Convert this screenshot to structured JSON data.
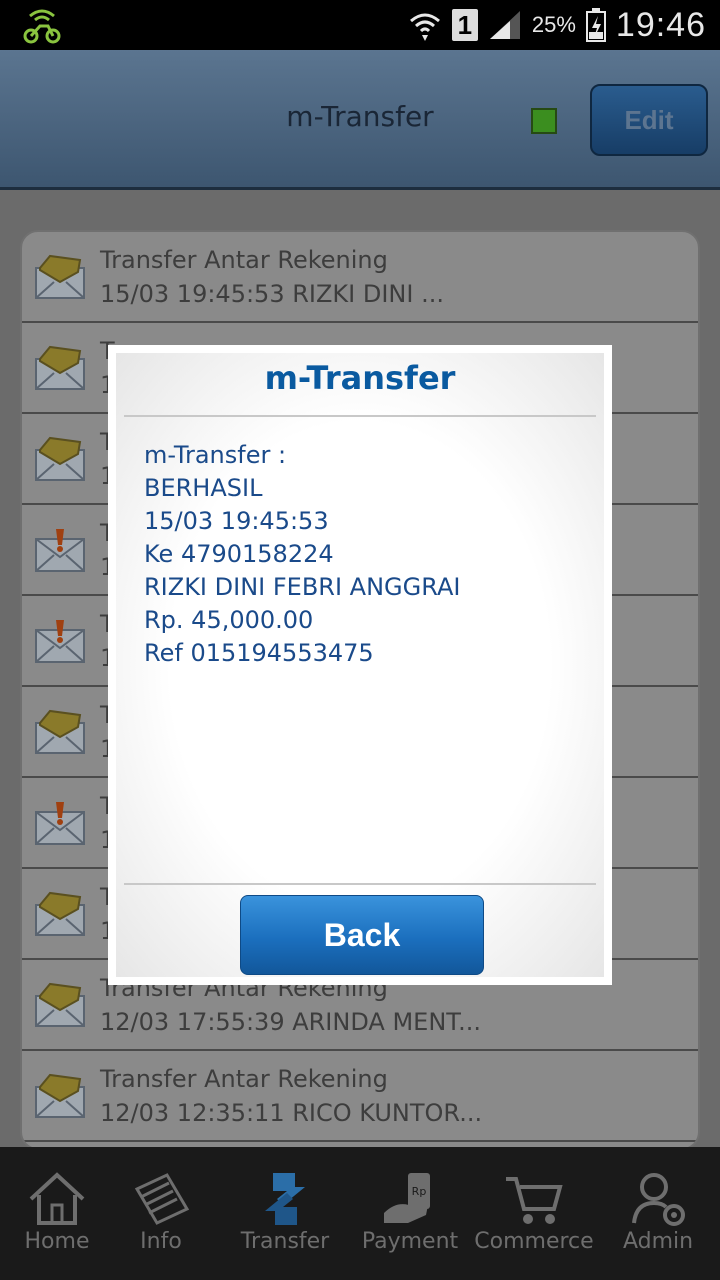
{
  "status_bar": {
    "sim_slot": "1",
    "battery_percent": "25%",
    "clock": "19:46",
    "icons": [
      "bike-notification-icon",
      "wifi-icon",
      "sim-icon",
      "signal-icon",
      "battery-icon"
    ]
  },
  "header": {
    "title": "m-Transfer",
    "edit_label": "Edit",
    "status_color": "#3b8e1f"
  },
  "inbox": {
    "items": [
      {
        "title": "Transfer Antar Rekening",
        "subtitle": "15/03 19:45:53 RIZKI DINI ...",
        "icon": "envelope-open-icon"
      },
      {
        "title": "T",
        "subtitle": "1",
        "icon": "envelope-open-icon"
      },
      {
        "title": "T",
        "subtitle": "1",
        "icon": "envelope-open-icon"
      },
      {
        "title": "T",
        "subtitle": "1",
        "icon": "envelope-flagged-icon"
      },
      {
        "title": "T",
        "subtitle": "1",
        "icon": "envelope-flagged-icon"
      },
      {
        "title": "T",
        "subtitle": "1",
        "icon": "envelope-open-icon"
      },
      {
        "title": "T",
        "subtitle": "1",
        "icon": "envelope-flagged-icon"
      },
      {
        "title": "T",
        "subtitle": "1",
        "icon": "envelope-open-icon"
      },
      {
        "title": "Transfer Antar Rekening",
        "subtitle": "12/03 17:55:39 ARINDA MENT...",
        "icon": "envelope-open-icon"
      },
      {
        "title": "Transfer Antar Rekening",
        "subtitle": "12/03 12:35:11 RICO KUNTOR...",
        "icon": "envelope-open-icon"
      }
    ]
  },
  "dialog": {
    "title": "m-Transfer",
    "lines": [
      "m-Transfer :",
      "BERHASIL",
      "15/03 19:45:53",
      "Ke 4790158224",
      "RIZKI DINI FEBRI ANGGRAI",
      "Rp. 45,000.00",
      "Ref 015194553475"
    ],
    "button_label": "Back"
  },
  "nav": {
    "items": [
      {
        "label": "Home",
        "icon": "home-icon"
      },
      {
        "label": "Info",
        "icon": "info-icon"
      },
      {
        "label": "Transfer",
        "icon": "transfer-icon"
      },
      {
        "label": "Payment",
        "icon": "payment-icon"
      },
      {
        "label": "Commerce",
        "icon": "cart-icon"
      },
      {
        "label": "Admin",
        "icon": "admin-icon"
      }
    ]
  }
}
